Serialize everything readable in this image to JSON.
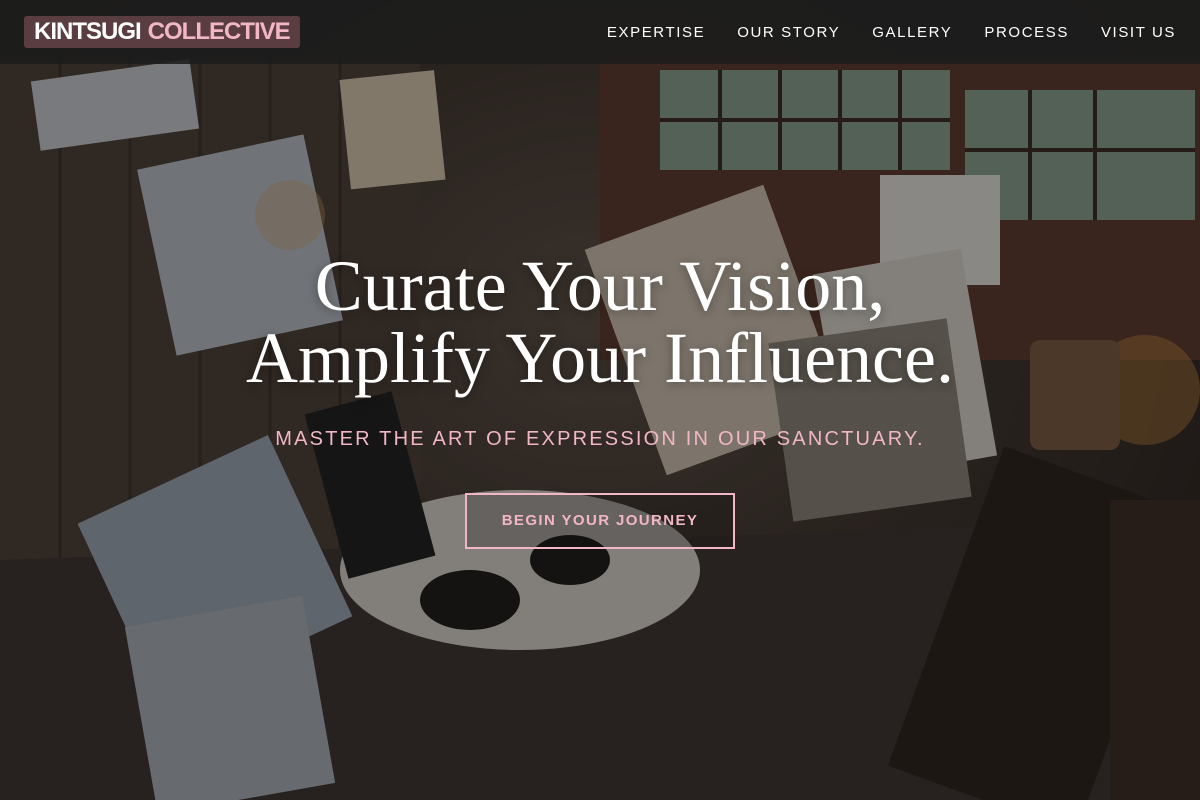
{
  "brand": {
    "part1": "KINTSUGI",
    "part2": "COLLECTIVE"
  },
  "nav": {
    "items": [
      {
        "label": "EXPERTISE"
      },
      {
        "label": "OUR STORY"
      },
      {
        "label": "GALLERY"
      },
      {
        "label": "PROCESS"
      },
      {
        "label": "VISIT US"
      }
    ]
  },
  "hero": {
    "title_line1": "Curate Your Vision,",
    "title_line2": "Amplify Your Influence.",
    "subtitle": "MASTER THE ART OF EXPRESSION IN OUR SANCTUARY.",
    "cta_label": "BEGIN YOUR JOURNEY",
    "image": "art-studio-photo"
  },
  "colors": {
    "accent": "#f2b6c6",
    "nav_bg": "#1c1c1c",
    "brand_bg": "#6e484e",
    "text": "#ffffff"
  }
}
